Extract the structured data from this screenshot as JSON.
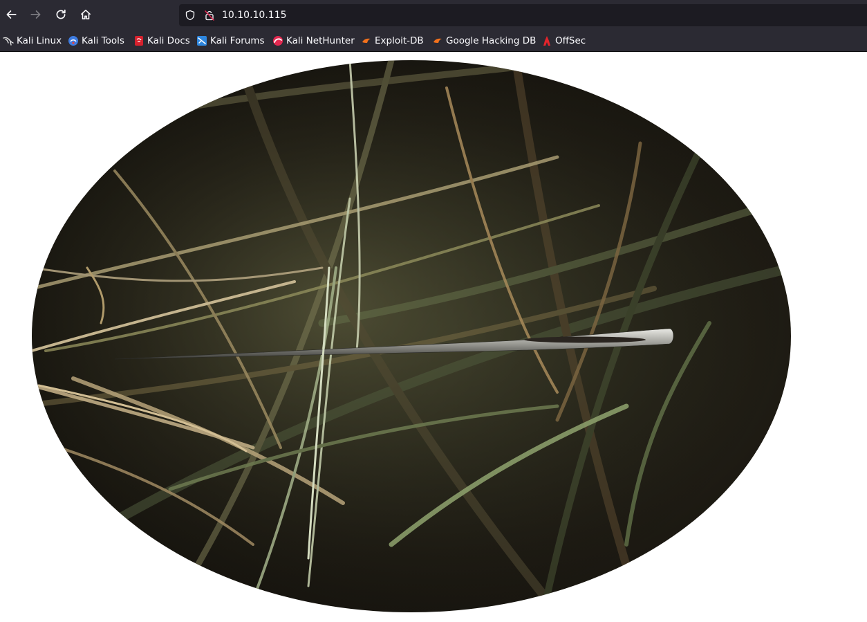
{
  "toolbar": {
    "back_icon": "arrow-left-icon",
    "forward_icon": "arrow-right-icon",
    "reload_icon": "reload-icon",
    "home_icon": "home-icon",
    "url": "10.10.10.115",
    "url_icons": [
      "shield-icon",
      "insecure-lock-icon"
    ]
  },
  "bookmarks": [
    {
      "label": "Kali Linux",
      "icon": "kali-dragon-icon"
    },
    {
      "label": "Kali Tools",
      "icon": "kali-tools-icon"
    },
    {
      "label": "Kali Docs",
      "icon": "kali-docs-icon"
    },
    {
      "label": "Kali Forums",
      "icon": "kali-forums-icon"
    },
    {
      "label": "Kali NetHunter",
      "icon": "kali-nethunter-icon"
    },
    {
      "label": "Exploit-DB",
      "icon": "exploit-db-icon"
    },
    {
      "label": "Google Hacking DB",
      "icon": "ghdb-icon"
    },
    {
      "label": "OffSec",
      "icon": "offsec-icon"
    }
  ],
  "content": {
    "image": "needle-in-haystack-image"
  },
  "colors": {
    "toolbar_bg": "#2b2a33",
    "urlbar_bg": "#1c1b22",
    "page_bg": "#ffffff",
    "text": "#fbfbfe"
  }
}
